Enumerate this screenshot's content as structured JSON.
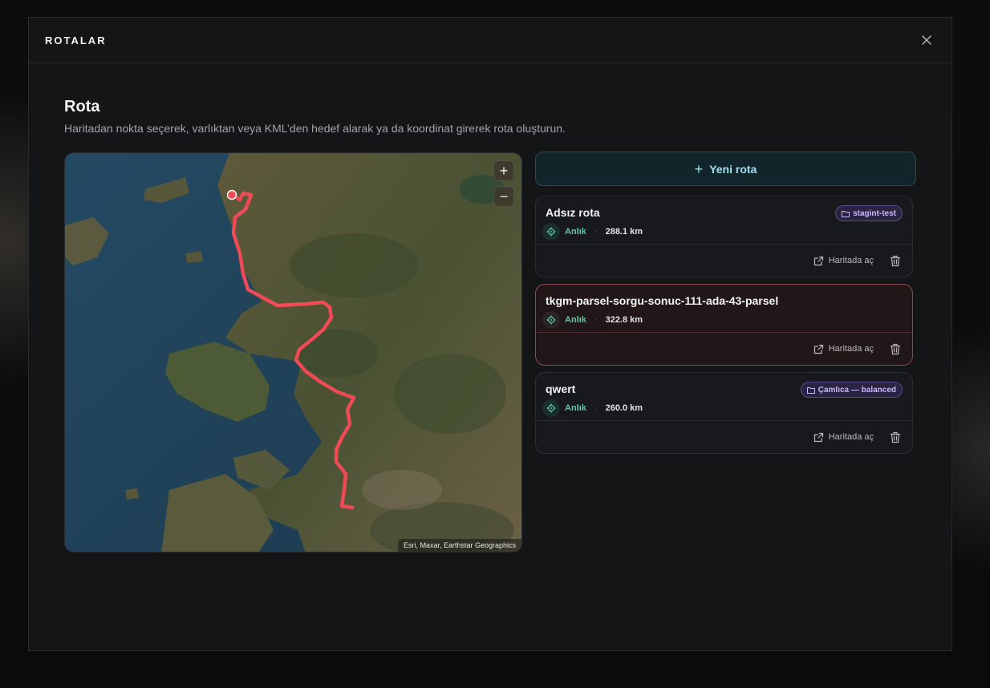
{
  "modal": {
    "title": "ROTALAR",
    "close_icon": "close-icon"
  },
  "section": {
    "title": "Rota",
    "description": "Haritadan nokta seçerek, varlıktan veya KML’den hedef alarak ya da koordinat girerek rota oluşturun."
  },
  "map": {
    "zoom_in": "+",
    "zoom_out": "−",
    "attribution": "Esri, Maxar, Earthstar Geographics",
    "route_color": "#ef4a55"
  },
  "new_route": {
    "icon": "plus-icon",
    "label": "Yeni rota"
  },
  "routes": [
    {
      "name": "Adsız rota",
      "tag": "stagint-test",
      "type": "Anlık",
      "separator": "·",
      "distance": "288.1 km",
      "open_label": "Haritada aç",
      "selected": false
    },
    {
      "name": "tkgm-parsel-sorgu-sonuc-111-ada-43-parsel",
      "tag": "",
      "type": "Anlık",
      "separator": "·",
      "distance": "322.8 km",
      "open_label": "Haritada aç",
      "selected": true
    },
    {
      "name": "qwert",
      "tag": "Çamlıca — balanced",
      "type": "Anlık",
      "separator": "·",
      "distance": "260.0 km",
      "open_label": "Haritada aç",
      "selected": false
    }
  ],
  "colors": {
    "accent": "#9fe0ef",
    "type_green": "#5fc9a6",
    "tag_purple": "#c7b8f5",
    "selected_border": "#8a4a4f"
  }
}
